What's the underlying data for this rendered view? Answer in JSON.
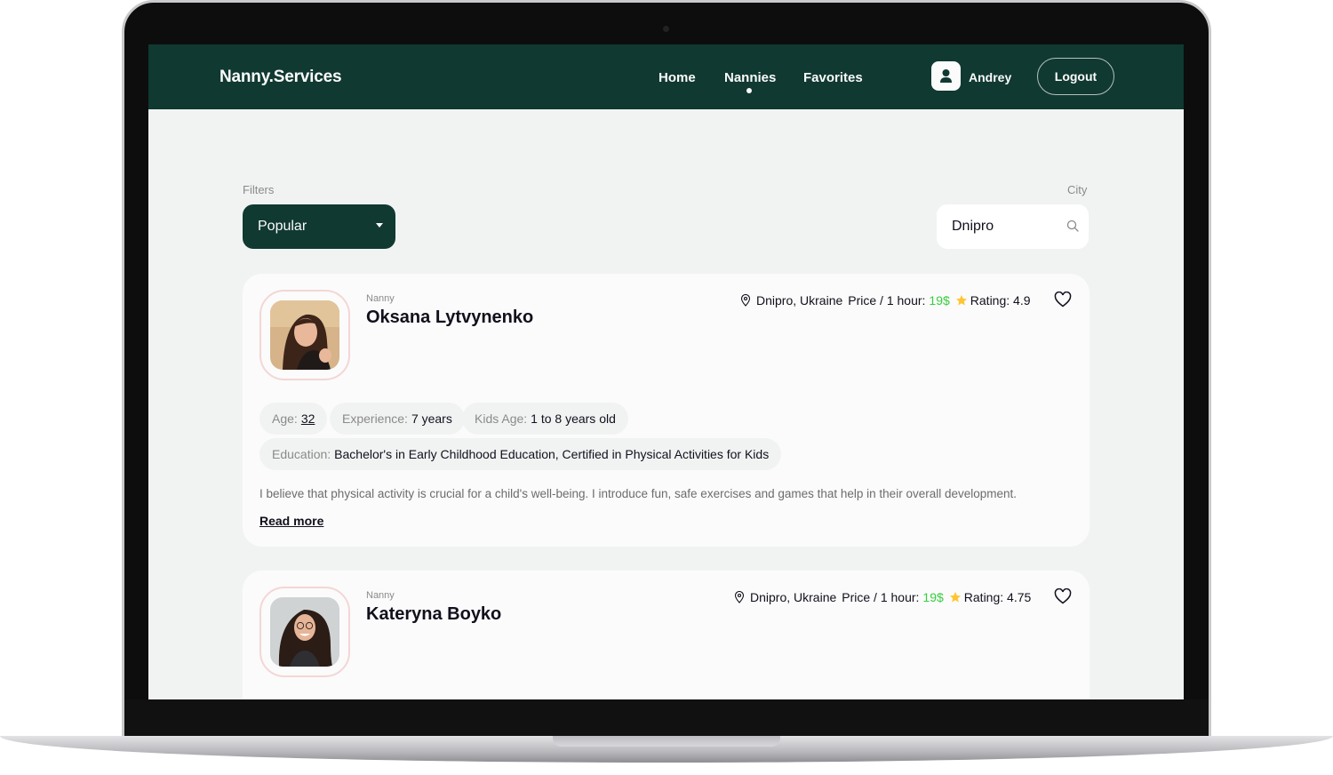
{
  "header": {
    "logo": "Nanny.Services",
    "nav": [
      {
        "label": "Home"
      },
      {
        "label": "Nannies",
        "active": true
      },
      {
        "label": "Favorites"
      }
    ],
    "user_name": "Andrey",
    "logout_label": "Logout"
  },
  "filters": {
    "label": "Filters",
    "selected": "Popular"
  },
  "city": {
    "label": "City",
    "value": "Dnipro"
  },
  "colors": {
    "brand": "#103931",
    "price": "#38cd3e",
    "star": "#ffc531",
    "background": "#f1f3f3"
  },
  "cards": [
    {
      "label": "Nanny",
      "name": "Oksana Lytvynenko",
      "location": "Dnipro, Ukraine",
      "price_label": "Price / 1 hour:",
      "price": "19$",
      "rating_label": "Rating: 4.9",
      "age_key": "Age:",
      "age": "32",
      "experience_key": "Experience:",
      "experience": "7 years",
      "kids_key": "Kids Age:",
      "kids": "1 to 8 years old",
      "education_key": "Education:",
      "education": "Bachelor's in Early Childhood Education, Certified in Physical Activities for Kids",
      "description": "I believe that physical activity is crucial for a child's well-being. I introduce fun, safe exercises and games that help in their overall development.",
      "read_more": "Read more"
    },
    {
      "label": "Nanny",
      "name": "Kateryna Boyko",
      "location": "Dnipro, Ukraine",
      "price_label": "Price / 1 hour:",
      "price": "19$",
      "rating_label": "Rating: 4.75"
    }
  ]
}
